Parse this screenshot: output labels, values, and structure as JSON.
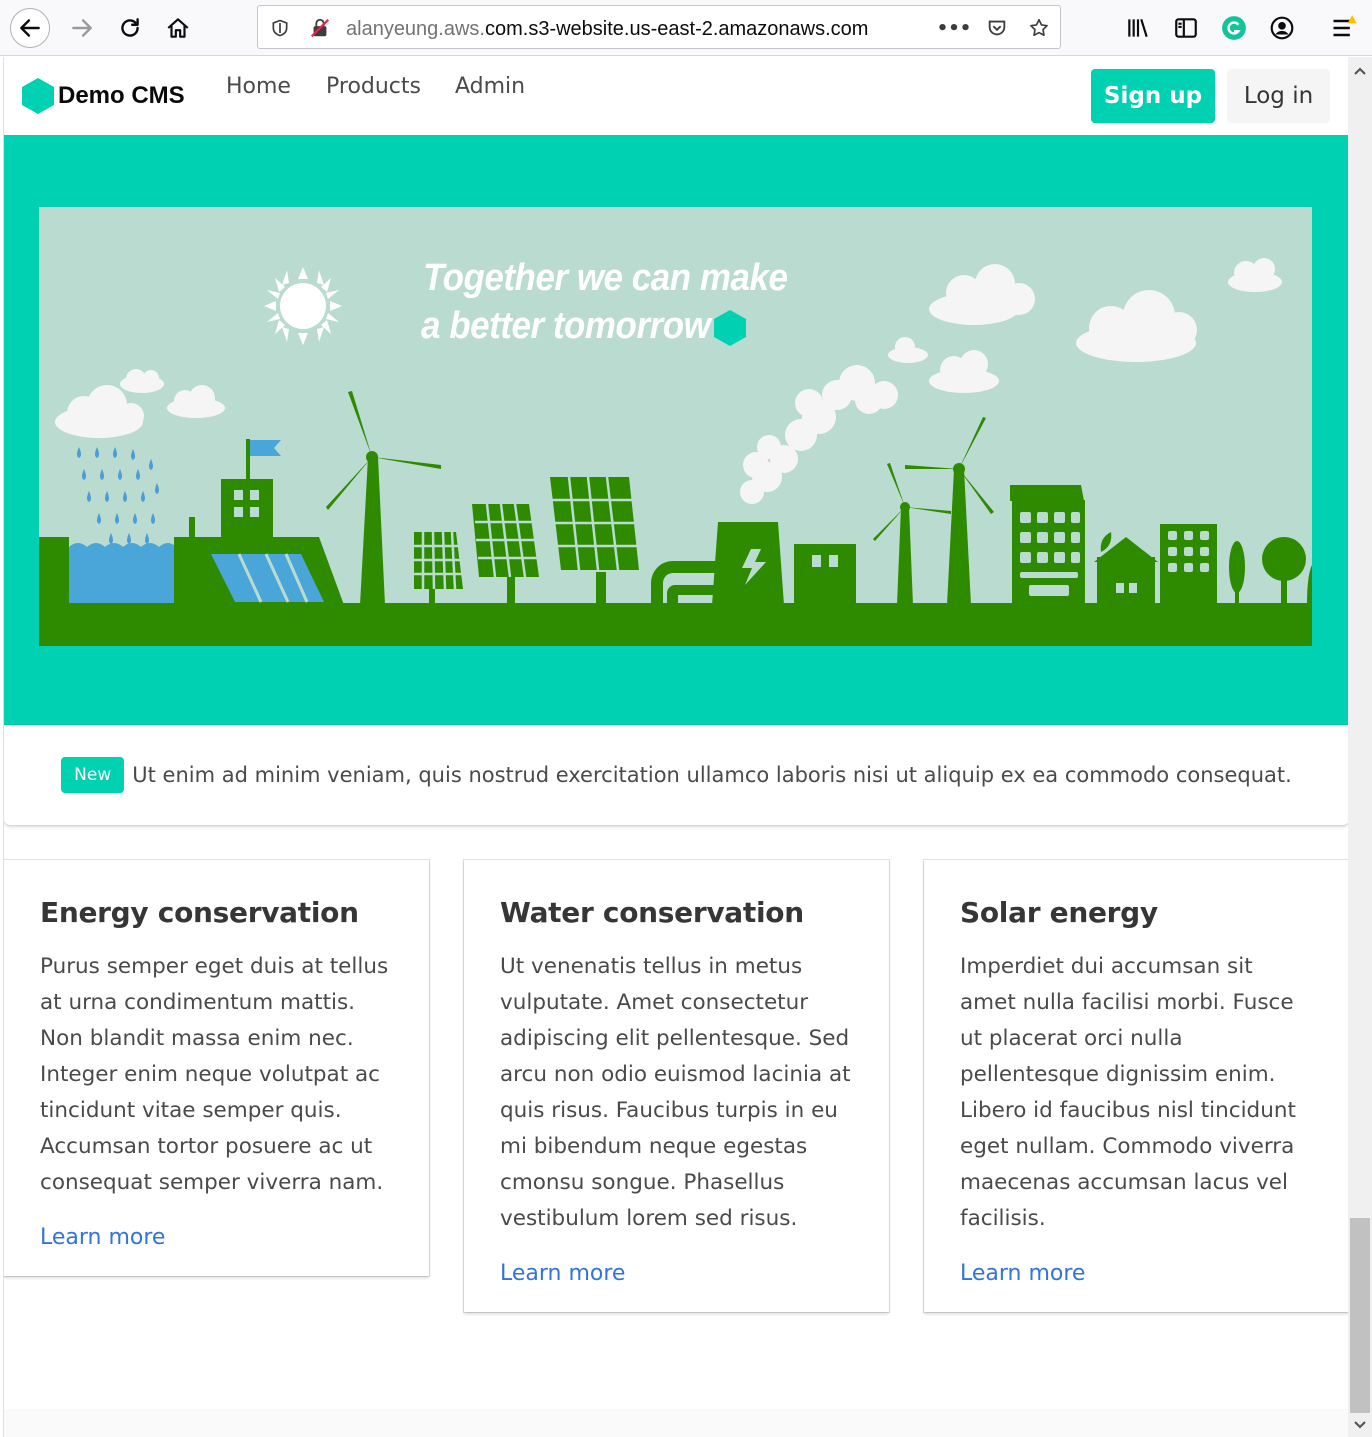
{
  "browser": {
    "url_prefix": "alanyeung.aws.",
    "url_domain": "com.s3-website.us-east-2.amazonaws.com",
    "menu_dots": "•••"
  },
  "navbar": {
    "brand": "Demo CMS",
    "links": [
      "Home",
      "Products",
      "Admin"
    ],
    "signup_label": "Sign up",
    "login_label": "Log in"
  },
  "hero": {
    "title_line1": "Together we can make",
    "title_line2": "a better tomorrow"
  },
  "notice": {
    "tag": "New",
    "text": "Ut enim ad minim veniam, quis nostrud exercitation ullamco laboris nisi ut aliquip ex ea commodo consequat."
  },
  "cards": [
    {
      "title": "Energy conservation",
      "body": "Purus semper eget duis at tellus at urna condimentum mattis. Non blandit massa enim nec. Integer enim neque volutpat ac tincidunt vitae semper quis. Accumsan tortor posuere ac ut consequat semper viverra nam.",
      "link": "Learn more"
    },
    {
      "title": "Water conservation",
      "body": "Ut venenatis tellus in metus vulputate. Amet consectetur adipiscing elit pellentesque. Sed arcu non odio euismod lacinia at quis risus. Faucibus turpis in eu mi bibendum neque egestas cmonsu songue. Phasellus vestibulum lorem sed risus.",
      "link": "Learn more"
    },
    {
      "title": "Solar energy",
      "body": "Imperdiet dui accumsan sit amet nulla facilisi morbi. Fusce ut placerat orci nulla pellentesque dignissim enim. Libero id faucibus nisl tincidunt eget nullam. Commodo viverra maecenas accumsan lacus vel facilisis.",
      "link": "Learn more"
    }
  ],
  "colors": {
    "primary": "#00d1b2",
    "link": "#3273dc",
    "hero_sky": "#b9dbd0",
    "hero_ground": "#2e8b00"
  }
}
